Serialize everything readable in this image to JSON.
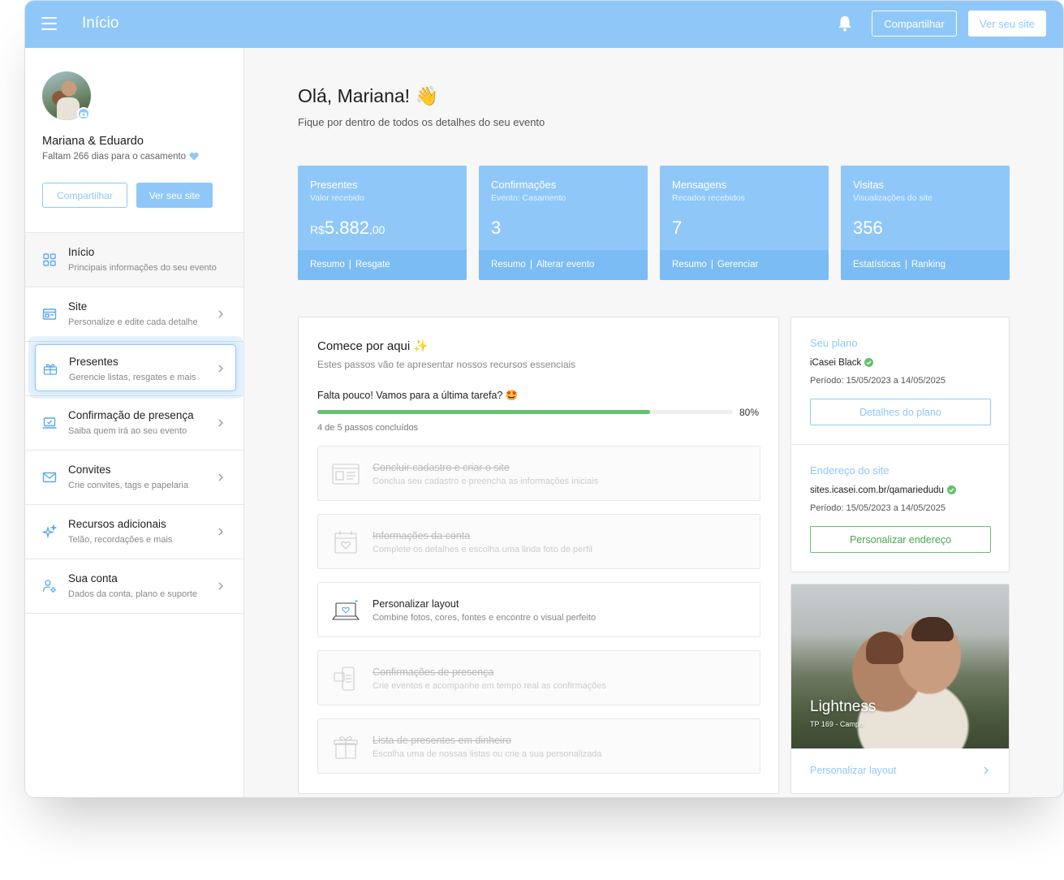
{
  "topbar": {
    "title": "Início",
    "share_label": "Compartilhar",
    "view_site_label": "Ver seu site",
    "colors": {
      "primary": "#8fc8f8",
      "primary_dark": "#7cbcf4",
      "success": "#67c06f"
    }
  },
  "profile": {
    "names": "Mariana & Eduardo",
    "countdown": "Faltam 266 dias para o casamento",
    "share_label": "Compartilhar",
    "view_site_label": "Ver seu site"
  },
  "nav": [
    {
      "label": "Início",
      "sub": "Principais informações do seu evento",
      "icon": "grid-icon"
    },
    {
      "label": "Site",
      "sub": "Personalize e edite cada detalhe",
      "icon": "browser-icon"
    },
    {
      "label": "Presentes",
      "sub": "Gerencie listas, resgates e mais",
      "icon": "gift-icon"
    },
    {
      "label": "Confirmação de presença",
      "sub": "Saiba quem irá ao seu evento",
      "icon": "laptop-check-icon"
    },
    {
      "label": "Convites",
      "sub": "Crie convites, tags e papelaria",
      "icon": "envelope-icon"
    },
    {
      "label": "Recursos adicionais",
      "sub": "Telão, recordações e mais",
      "icon": "sparkle-icon"
    },
    {
      "label": "Sua conta",
      "sub": "Dados da conta, plano e suporte",
      "icon": "user-gear-icon"
    }
  ],
  "greeting": {
    "title": "Olá, Mariana! 👋",
    "subtitle": "Fique por dentro de todos os detalhes do seu evento"
  },
  "stats": [
    {
      "title": "Presentes",
      "sub": "Valor recebido",
      "currency": "R$",
      "value": "5.882",
      "cents": ",00",
      "link1": "Resumo",
      "link2": "Resgate"
    },
    {
      "title": "Confirmações",
      "sub": "Evento: Casamento",
      "value": "3",
      "link1": "Resumo",
      "link2": "Alterar evento"
    },
    {
      "title": "Mensagens",
      "sub": "Recados recebidos",
      "value": "7",
      "link1": "Resumo",
      "link2": "Gerenciar"
    },
    {
      "title": "Visitas",
      "sub": "Visualizações do site",
      "value": "356",
      "link1": "Estatísticas",
      "link2": "Ranking"
    }
  ],
  "start": {
    "title": "Comece por aqui ✨",
    "subtitle": "Estes passos vão te apresentar nossos recursos essenciais",
    "almost": "Falta pouco! Vamos para a última tarefa? 🤩",
    "progress_percent": 80,
    "progress_label": "80%",
    "steps_done": "4 de 5 passos concluídos",
    "tasks": [
      {
        "title": "Concluir cadastro e criar o site",
        "sub": "Conclua seu cadastro e preencha as informações iniciais",
        "done": true
      },
      {
        "title": "Informações da conta",
        "sub": "Complete os detalhes e escolha uma linda foto de perfil",
        "done": true
      },
      {
        "title": "Personalizar layout",
        "sub": "Combine fotos, cores, fontes e encontre o visual perfeito",
        "done": false
      },
      {
        "title": "Confirmações de presença",
        "sub": "Crie eventos e acompanhe em tempo real as confirmações",
        "done": true
      },
      {
        "title": "Lista de presentes em dinheiro",
        "sub": "Escolha uma de nossas listas ou crie a sua personalizada",
        "done": true
      }
    ]
  },
  "plan": {
    "title": "Seu plano",
    "name": "iCasei Black",
    "period": "Período: 15/05/2023 a 14/05/2025",
    "button": "Detalhes do plano"
  },
  "address": {
    "title": "Endereço do site",
    "url": "sites.icasei.com.br/qamariedudu",
    "period": "Período: 15/05/2023 a 14/05/2025",
    "button": "Personalizar endereço"
  },
  "layout": {
    "name": "Lightness",
    "code": "TP 169 - Campo",
    "link": "Personalizar layout"
  }
}
